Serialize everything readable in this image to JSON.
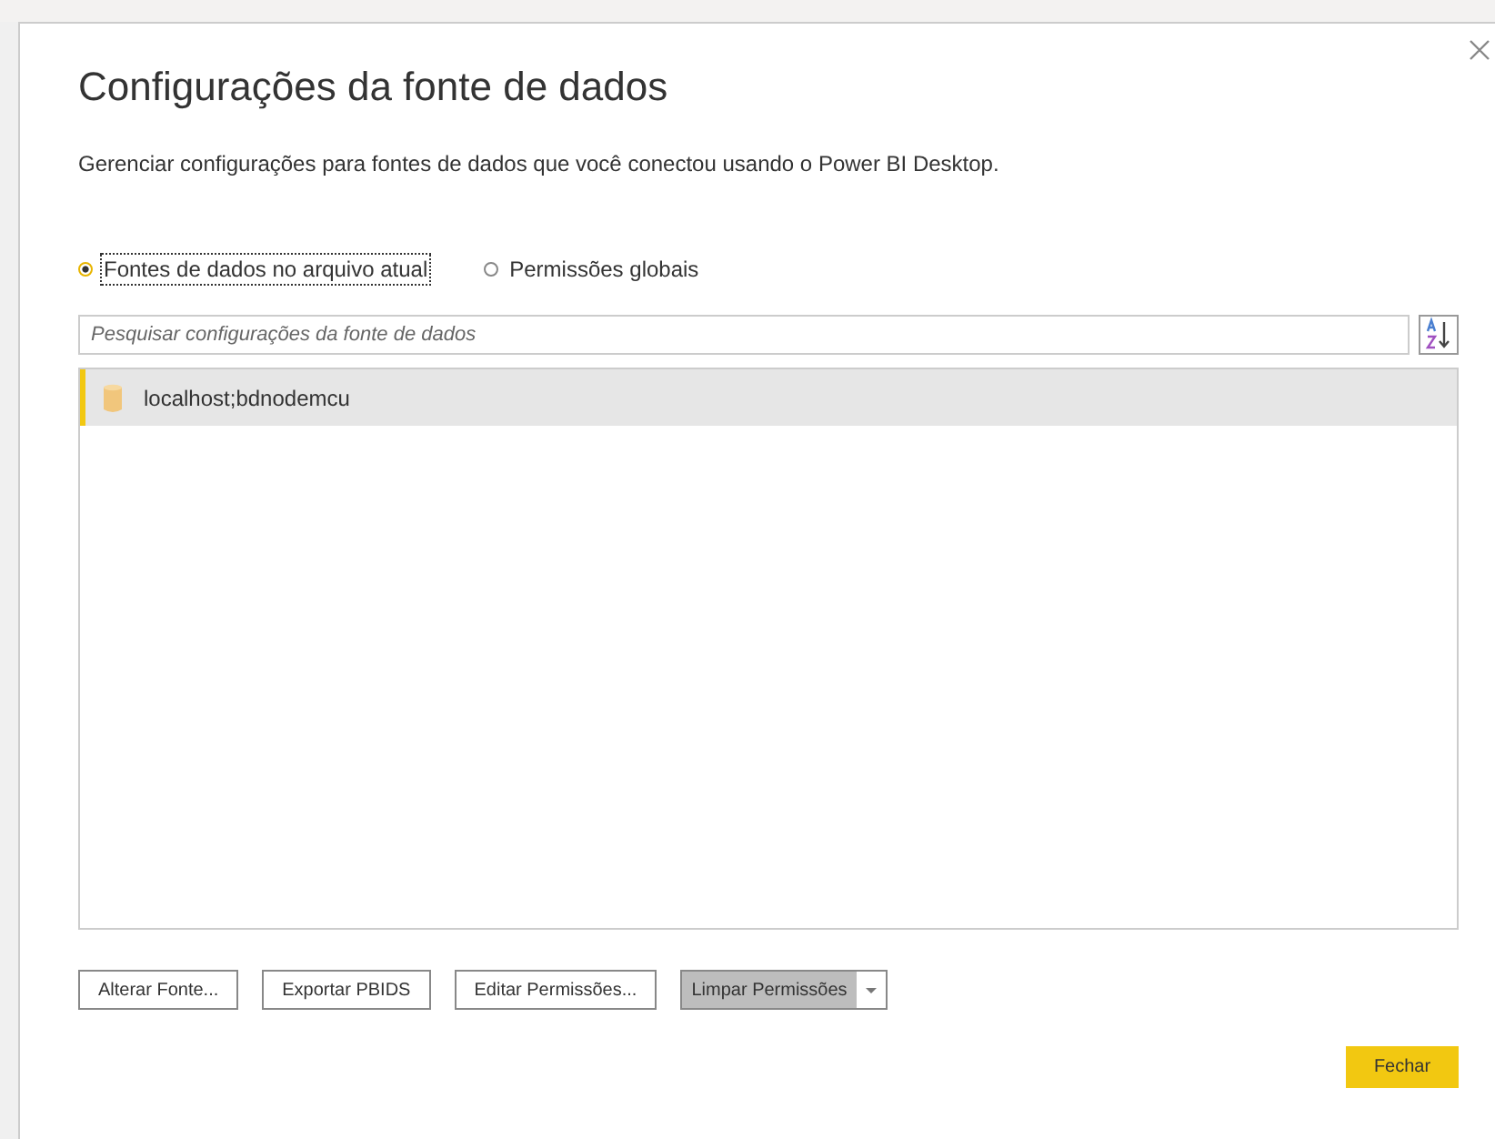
{
  "dialog": {
    "title": "Configurações da fonte de dados",
    "description": "Gerenciar configurações para fontes de dados que você conectou usando o Power BI Desktop."
  },
  "scope_options": [
    {
      "label": "Fontes de dados no arquivo atual",
      "selected": true
    },
    {
      "label": "Permissões globais",
      "selected": false
    }
  ],
  "search": {
    "placeholder": "Pesquisar configurações da fonte de dados"
  },
  "sources": [
    {
      "name": "localhost;bdnodemcu",
      "selected": true
    }
  ],
  "buttons": [
    {
      "label": "Alterar Fonte...",
      "kind": "plain"
    },
    {
      "label": "Exportar PBIDS",
      "kind": "plain"
    },
    {
      "label": "Editar Permissões...",
      "kind": "plain"
    },
    {
      "label": "Limpar Permissões",
      "kind": "split"
    }
  ],
  "close_button": {
    "label": "Fechar"
  }
}
